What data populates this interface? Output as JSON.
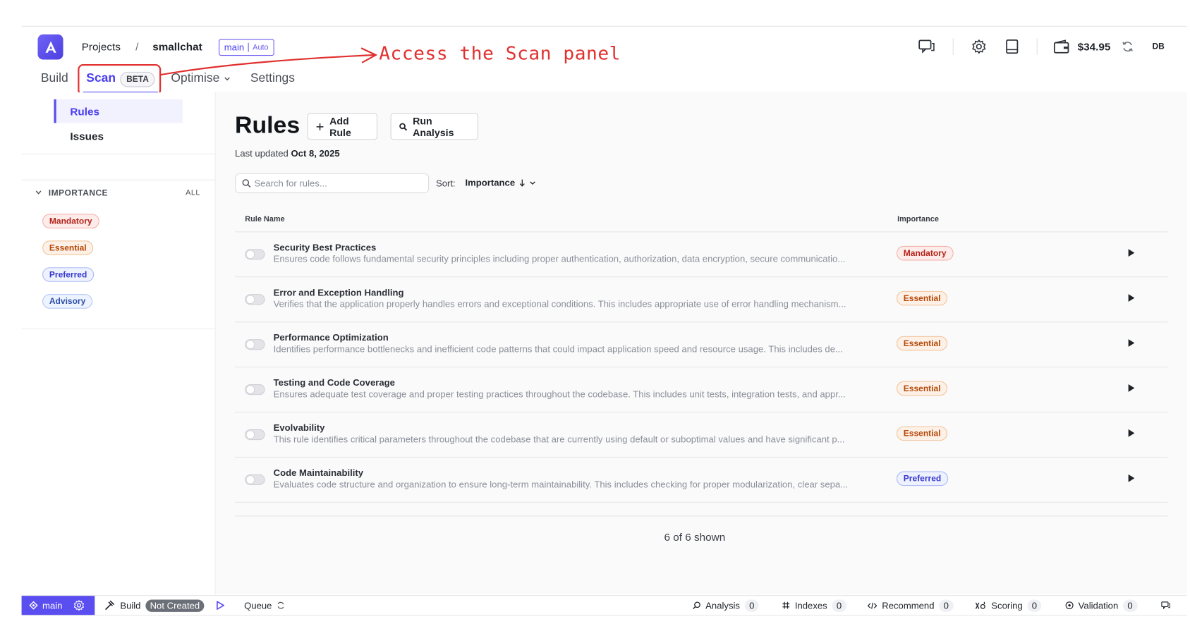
{
  "header": {
    "projects_label": "Projects",
    "separator": "/",
    "project_name": "smallchat",
    "branch": "main",
    "branch_mode": "Auto",
    "balance": "$34.95",
    "user_initials": "DB",
    "icons": [
      "chat-icon",
      "settings-icon",
      "docs-icon",
      "wallet-icon",
      "refresh-icon"
    ]
  },
  "annotation": {
    "text": "Access the Scan panel",
    "color": "#e0302f"
  },
  "tabs": {
    "build": "Build",
    "scan": "Scan",
    "scan_badge": "BETA",
    "optimise": "Optimise",
    "settings": "Settings",
    "active": "Scan"
  },
  "sidebar": {
    "nav": [
      {
        "label": "Rules",
        "active": true
      },
      {
        "label": "Issues",
        "active": false
      }
    ],
    "filter": {
      "title": "IMPORTANCE",
      "all_label": "ALL",
      "options": [
        "Mandatory",
        "Essential",
        "Preferred",
        "Advisory"
      ]
    }
  },
  "page": {
    "title": "Rules",
    "add_rule": "Add Rule",
    "run_analysis": "Run Analysis",
    "updated_prefix": "Last updated",
    "updated_date": "Oct 8, 2025",
    "search_placeholder": "Search for rules...",
    "sort_label": "Sort:",
    "sort_value": "Importance",
    "footer": "6 of 6 shown"
  },
  "table": {
    "columns": [
      "Rule Name",
      "Importance"
    ],
    "rows": [
      {
        "name": "Security Best Practices",
        "description": "Ensures code follows fundamental security principles including proper authentication, authorization, data encryption, secure communicatio...",
        "importance": "Mandatory",
        "enabled": false
      },
      {
        "name": "Error and Exception Handling",
        "description": "Verifies that the application properly handles errors and exceptional conditions. This includes appropriate use of error handling mechanism...",
        "importance": "Essential",
        "enabled": false
      },
      {
        "name": "Performance Optimization",
        "description": "Identifies performance bottlenecks and inefficient code patterns that could impact application speed and resource usage. This includes de...",
        "importance": "Essential",
        "enabled": false
      },
      {
        "name": "Testing and Code Coverage",
        "description": "Ensures adequate test coverage and proper testing practices throughout the codebase. This includes unit tests, integration tests, and appr...",
        "importance": "Essential",
        "enabled": false
      },
      {
        "name": "Evolvability",
        "description": "This rule identifies critical parameters throughout the codebase that are currently using default or suboptimal values and have significant p...",
        "importance": "Essential",
        "enabled": false
      },
      {
        "name": "Code Maintainability",
        "description": "Evaluates code structure and organization to ensure long-term maintainability. This includes checking for proper modularization, clear sepa...",
        "importance": "Preferred",
        "enabled": false
      }
    ]
  },
  "statusbar": {
    "branch": "main",
    "build_label": "Build",
    "build_status": "Not Created",
    "queue_label": "Queue",
    "analysis_label": "Analysis",
    "analysis_count": "0",
    "indexes_label": "Indexes",
    "indexes_count": "0",
    "recommend_label": "Recommend",
    "recommend_count": "0",
    "scoring_label": "Scoring",
    "scoring_count": "0",
    "validation_label": "Validation",
    "validation_count": "0"
  },
  "colors": {
    "accent": "#5b4ef0",
    "mandatory": "#b42318",
    "essential": "#b54708",
    "preferred": "#3538cd",
    "advisory": "#2d4fa8"
  }
}
